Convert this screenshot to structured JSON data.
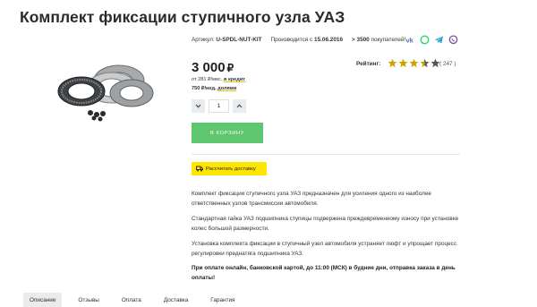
{
  "product": {
    "title": "Комплект фиксации ступичного узла УАЗ",
    "article_label": "Артикул:",
    "article_value": "U-SPDL-NUT-KIT",
    "produced_label": "Производится с",
    "produced_value": "15.06.2016",
    "buyers_value": "> 3500",
    "buyers_label": "покупателей!"
  },
  "social": [
    "vk-icon",
    "whatsapp-icon",
    "telegram-icon",
    "viber-icon"
  ],
  "price": {
    "value": "3 000",
    "currency": "₽",
    "credit_prefix": "от 281 ₽/мес. ",
    "credit_link": "в кредит",
    "installment_prefix": "750 ₽/нед. ",
    "installment_link": "долями"
  },
  "rating": {
    "label": "Рейтинг:",
    "stars": 3.5,
    "max_stars": 5,
    "count": "( 247 )"
  },
  "quantity": {
    "value": "1"
  },
  "buttons": {
    "cart": "В КОРЗИНУ",
    "shipping": "Рассчитать доставку"
  },
  "description": {
    "p1": "Комплект фиксации ступичного узла УАЗ предназначен для усиления одного из наиболее ответственных узлов трансмиссии автомобиля.",
    "p2": "Стандартная гайка УАЗ подшипника ступицы подвержена преждевременному износу при установке колес большой размерности.",
    "p3": "Установка комплекта фиксации в ступичный узел автомобиля устраняет люфт и упрощает процесс регулировки преднатяга подшипника УАЗ.",
    "p4": "При оплате онлайн, банковской картой, до 11:00 (МСК) в будние дни, отправка заказа в день оплаты!"
  },
  "tabs": [
    "Описание",
    "Отзывы",
    "Оплата",
    "Доставка",
    "Гарантия"
  ],
  "colors": {
    "cart_button": "#5dc66f",
    "shipping_button": "#ffe600",
    "star": "#c9a300",
    "vk": "#4a76a8",
    "whatsapp": "#25d366",
    "telegram": "#2aa3dd",
    "viber": "#7b519d"
  }
}
